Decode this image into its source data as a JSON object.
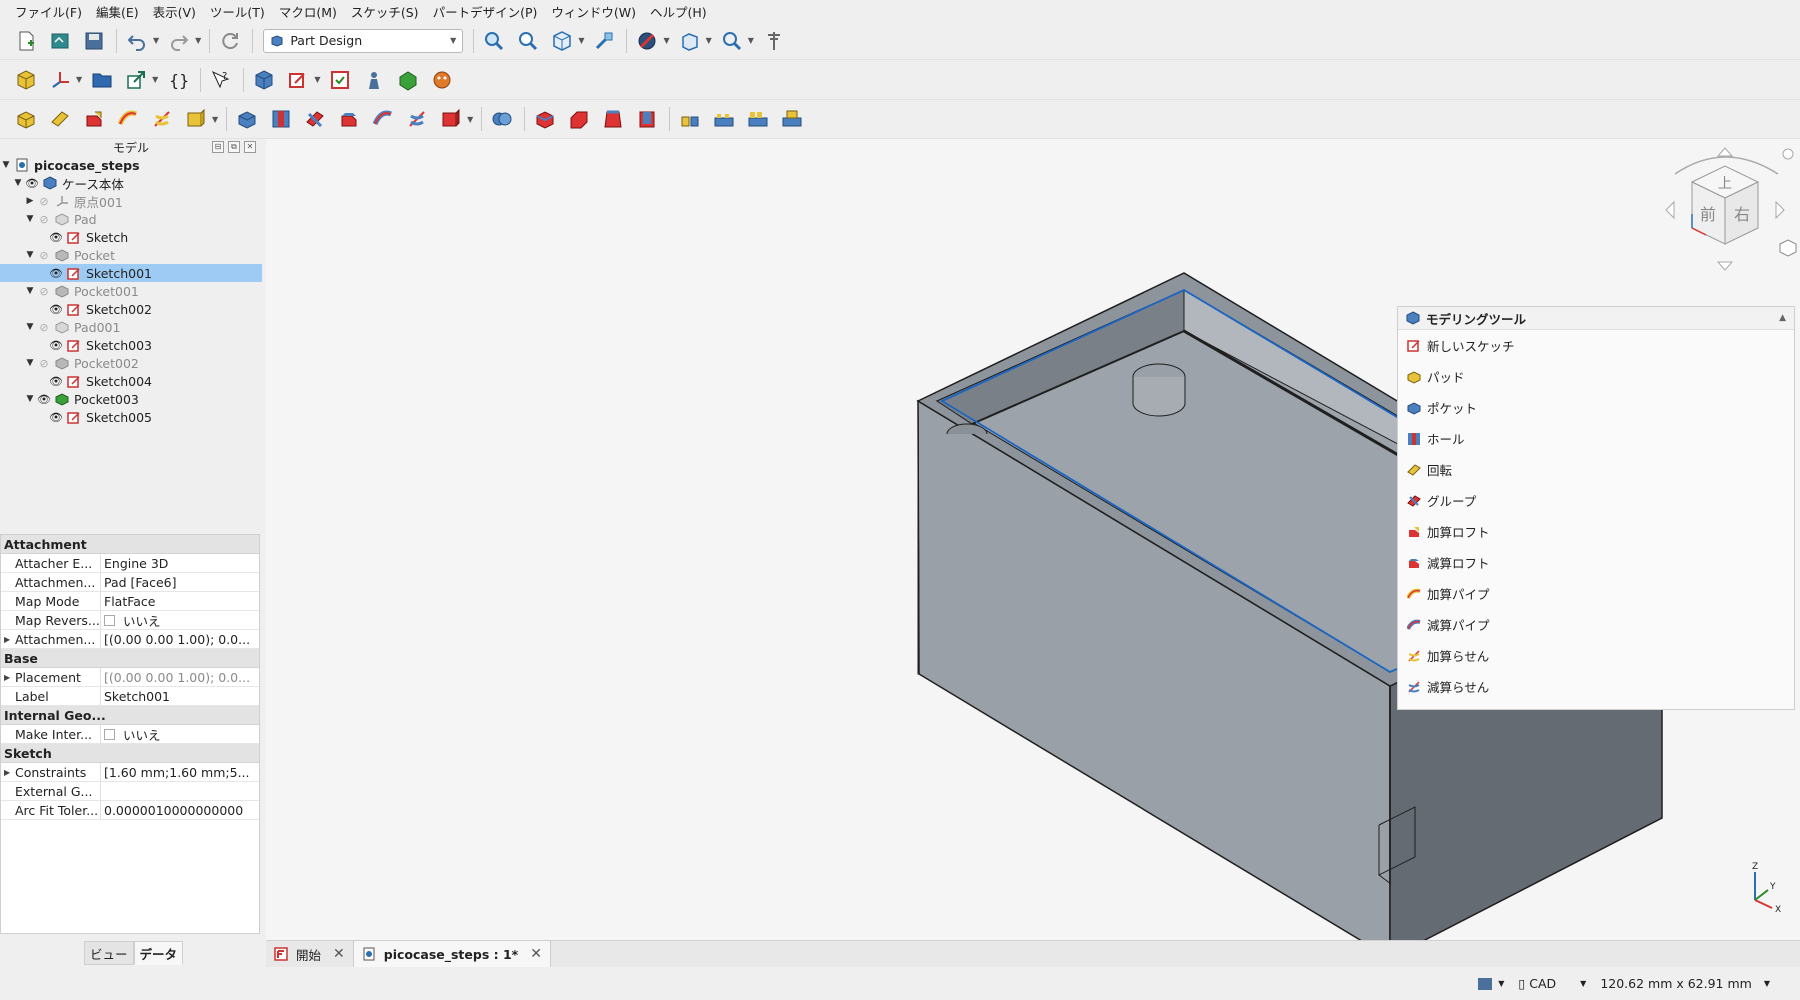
{
  "menubar": {
    "items": [
      "ファイル(F)",
      "編集(E)",
      "表示(V)",
      "ツール(T)",
      "マクロ(M)",
      "スケッチ(S)",
      "パートデザイン(P)",
      "ウィンドウ(W)",
      "ヘルプ(H)"
    ]
  },
  "toolbar": {
    "workbench": "Part Design"
  },
  "model_panel": {
    "title": "モデル",
    "tree": [
      {
        "label": "picocase_steps",
        "style": "bold"
      },
      {
        "label": "ケース本体",
        "style": "normal"
      },
      {
        "label": "原点001",
        "style": "grey"
      },
      {
        "label": "Pad",
        "style": "grey"
      },
      {
        "label": "Sketch",
        "style": "normal"
      },
      {
        "label": "Pocket",
        "style": "grey"
      },
      {
        "label": "Sketch001",
        "style": "selected"
      },
      {
        "label": "Pocket001",
        "style": "grey"
      },
      {
        "label": "Sketch002",
        "style": "normal"
      },
      {
        "label": "Pad001",
        "style": "grey"
      },
      {
        "label": "Sketch003",
        "style": "normal"
      },
      {
        "label": "Pocket002",
        "style": "grey"
      },
      {
        "label": "Sketch004",
        "style": "normal"
      },
      {
        "label": "Pocket003",
        "style": "normal"
      },
      {
        "label": "Sketch005",
        "style": "normal"
      }
    ]
  },
  "properties": {
    "groups": [
      {
        "name": "Attachment",
        "rows": [
          {
            "key": "Attacher E...",
            "value": "Engine 3D"
          },
          {
            "key": "Attachmen...",
            "value": "Pad [Face6]"
          },
          {
            "key": "Map Mode",
            "value": "FlatFace"
          },
          {
            "key": "Map Revers...",
            "value": "いいえ",
            "checkbox": true
          },
          {
            "key": "Attachmen...",
            "value": "[(0.00 0.00 1.00); 0.0..."
          }
        ]
      },
      {
        "name": "Base",
        "rows": [
          {
            "key": "Placement",
            "value": "[(0.00 0.00 1.00); 0.0..."
          },
          {
            "key": "Label",
            "value": "Sketch001"
          }
        ]
      },
      {
        "name": "Internal Geo...",
        "rows": [
          {
            "key": "Make Inter...",
            "value": "いいえ",
            "checkbox": true
          }
        ]
      },
      {
        "name": "Sketch",
        "rows": [
          {
            "key": "Constraints",
            "value": "[1.60 mm;1.60 mm;5..."
          },
          {
            "key": "External G...",
            "value": ""
          },
          {
            "key": "Arc Fit Toler...",
            "value": "0.0000010000000000"
          }
        ]
      }
    ],
    "tabs": [
      "ビュー",
      "データ"
    ]
  },
  "tools_panel": {
    "title": "モデリングツール",
    "items": [
      "新しいスケッチ",
      "パッド",
      "ポケット",
      "ホール",
      "回転",
      "グループ",
      "加算ロフト",
      "減算ロフト",
      "加算パイプ",
      "減算パイプ",
      "加算らせん",
      "減算らせん"
    ]
  },
  "navcube": {
    "top": "上",
    "front": "前",
    "right": "右"
  },
  "axes": {
    "z": "Z",
    "y": "Y",
    "x": "X"
  },
  "doc_tabs": {
    "start": "開始",
    "doc": "picocase_steps : 1*"
  },
  "status": {
    "nav_style": "CAD",
    "dimensions": "120.62 mm x 62.91 mm"
  }
}
